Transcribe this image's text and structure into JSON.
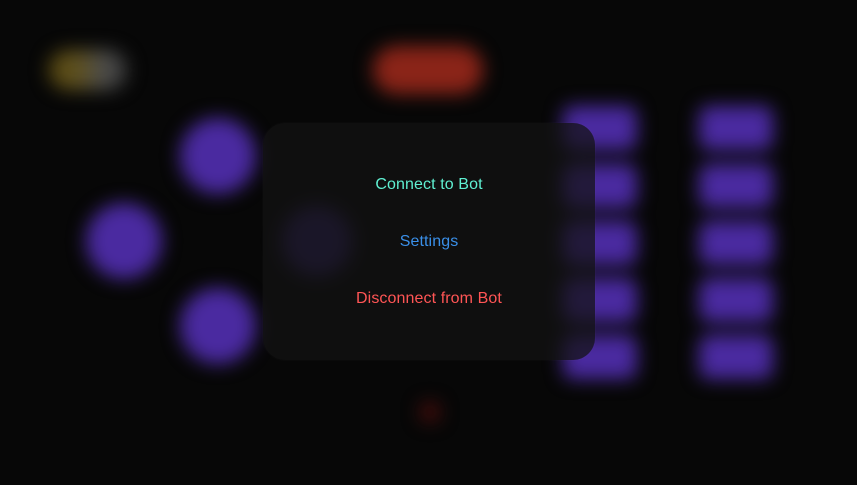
{
  "menu": {
    "connect_label": "Connect to Bot",
    "settings_label": "Settings",
    "disconnect_label": "Disconnect from Bot"
  },
  "colors": {
    "background": "#070707",
    "connect": "#5ff0d2",
    "settings": "#3a8fe8",
    "disconnect": "#ff5555",
    "accent_purple": "#4a2aa0",
    "record_red": "#8a2418"
  },
  "icons": {
    "logo": "logo-icon"
  }
}
